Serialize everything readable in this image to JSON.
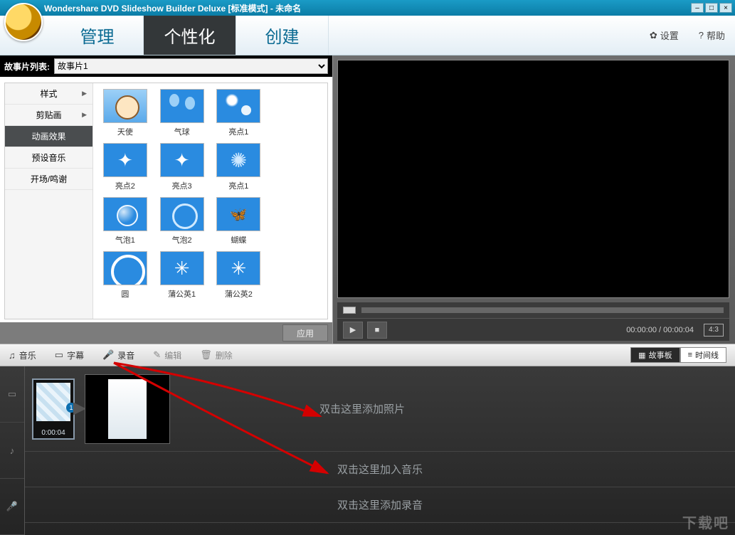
{
  "title": "Wondershare DVD Slideshow Builder Deluxe [标准模式] - 未命名",
  "tabs": {
    "manage": "管理",
    "personalize": "个性化",
    "create": "创建"
  },
  "header": {
    "settings": "设置",
    "help": "帮助"
  },
  "story": {
    "label": "故事片列表:",
    "selected": "故事片1"
  },
  "categories": {
    "style": "样式",
    "clipart": "剪贴画",
    "animation": "动画效果",
    "music": "预设音乐",
    "intro": "开场/鸣谢"
  },
  "effects": [
    {
      "id": "angel",
      "label": "天使"
    },
    {
      "id": "balloon",
      "label": "气球"
    },
    {
      "id": "light1",
      "label": "亮点1"
    },
    {
      "id": "blank1",
      "label": ""
    },
    {
      "id": "light2",
      "label": "亮点2"
    },
    {
      "id": "light3",
      "label": "亮点3"
    },
    {
      "id": "light1b",
      "label": "亮点1"
    },
    {
      "id": "blank2",
      "label": ""
    },
    {
      "id": "bubble1",
      "label": "气泡1"
    },
    {
      "id": "bubble2",
      "label": "气泡2"
    },
    {
      "id": "butterfly",
      "label": "蝴蝶"
    },
    {
      "id": "blank3",
      "label": ""
    },
    {
      "id": "circle",
      "label": "圆"
    },
    {
      "id": "dand1",
      "label": "蒲公英1"
    },
    {
      "id": "dand2",
      "label": "蒲公英2"
    },
    {
      "id": "blank4",
      "label": ""
    }
  ],
  "apply": "应用",
  "player": {
    "time": "00:00:00 / 00:00:04",
    "aspect": "4:3"
  },
  "toolbar": {
    "music": "音乐",
    "subtitle": "字幕",
    "record": "录音",
    "edit": "编辑",
    "delete": "删除",
    "storyboard": "故事板",
    "timeline": "时间线"
  },
  "timeline": {
    "clip_duration": "0:00:04",
    "clip_badge": "1",
    "add_photo": "双击这里添加照片",
    "add_music": "双击这里加入音乐",
    "add_voice": "双击这里添加录音"
  },
  "watermark": "下载吧"
}
